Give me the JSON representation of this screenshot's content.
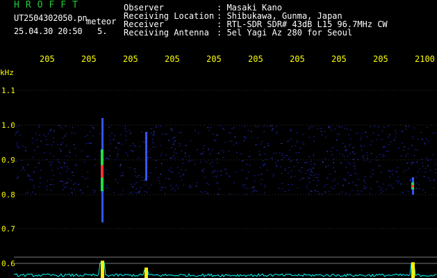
{
  "header": {
    "brand": "HROFFT",
    "filename": "UT2504302050.pn",
    "mode_label": "meteor",
    "datetime": "25.04.30 20:50",
    "seq": "5.",
    "info": [
      {
        "label": "Observer",
        "value": ": Masaki Kano"
      },
      {
        "label": "Receiving Location",
        "value": ": Shibukawa, Gunma, Japan"
      },
      {
        "label": "Receiver",
        "value": ": RTL-SDR SDR# 43dB L15 96.7MHz CW"
      },
      {
        "label": "Receiving Antenna",
        "value": ": 5el Yagi Az 280 for Seoul"
      }
    ]
  },
  "time_axis": {
    "ticks": [
      "205",
      "205",
      "205",
      "205",
      "205",
      "205",
      "205",
      "205",
      "205",
      "2100"
    ]
  },
  "freq_axis": {
    "unit": "kHz",
    "ticks": [
      "1.1",
      "1.0",
      "0.9",
      "0.8",
      "0.7",
      "0.6"
    ]
  },
  "colors": {
    "brand": "#22cc33",
    "text": "#ffffff",
    "axis": "#ffff00",
    "background": "#000000",
    "noise": "#1a22aa",
    "signal_hot": "#ff3333",
    "signal_mid": "#22dd44",
    "baseline": "#00ffff"
  },
  "signals": [
    {
      "t": 147,
      "f_top": 1.02,
      "f_bottom": 0.72,
      "strength": 0.95
    },
    {
      "t": 210,
      "f_top": 0.98,
      "f_bottom": 0.84,
      "strength": 0.5
    },
    {
      "t": 594,
      "f_top": 0.85,
      "f_bottom": 0.8,
      "strength": 0.85
    }
  ]
}
